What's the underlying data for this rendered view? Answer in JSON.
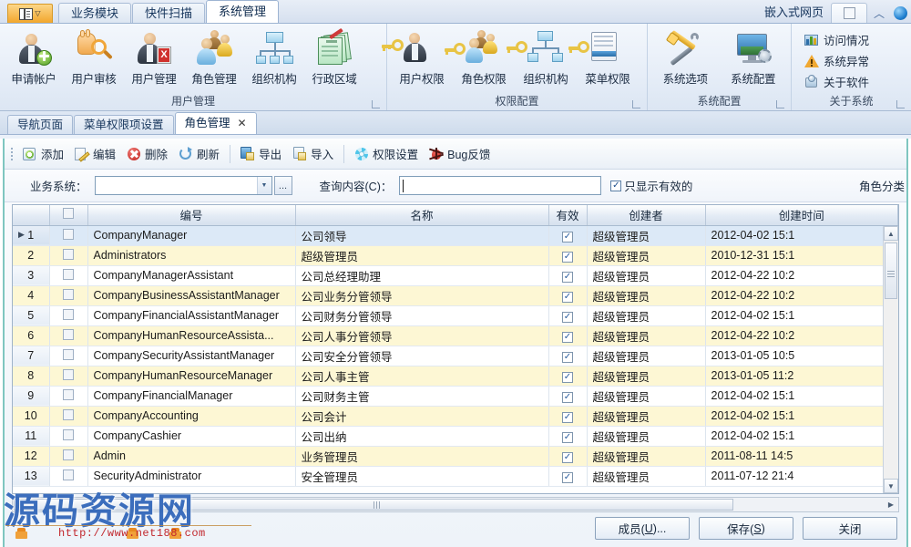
{
  "window": {
    "app_menu_icon": "book-menu-icon",
    "main_tabs": [
      {
        "label": "业务模块",
        "active": false
      },
      {
        "label": "快件扫描",
        "active": false
      },
      {
        "label": "系统管理",
        "active": true
      }
    ],
    "embedded_page_label": "嵌入式网页",
    "restore_icon": "restore-window-icon",
    "collapse_icon": "chevron-up-icon",
    "help_icon": "globe-help-icon"
  },
  "ribbon": {
    "groups": [
      {
        "title": "用户管理",
        "buttons": [
          {
            "label": "申请帐户",
            "icon": "user-add-icon"
          },
          {
            "label": "用户审核",
            "icon": "user-review-magnifier-icon"
          },
          {
            "label": "用户管理",
            "icon": "user-manage-icon"
          },
          {
            "label": "角色管理",
            "icon": "role-group-icon"
          },
          {
            "label": "组织机构",
            "icon": "org-chart-icon"
          },
          {
            "label": "行政区域",
            "icon": "region-book-icon"
          }
        ]
      },
      {
        "title": "权限配置",
        "buttons": [
          {
            "label": "用户权限",
            "icon": "user-key-icon"
          },
          {
            "label": "角色权限",
            "icon": "role-key-icon"
          },
          {
            "label": "组织机构",
            "icon": "org-key-icon"
          },
          {
            "label": "菜单权限",
            "icon": "menu-key-icon"
          }
        ]
      },
      {
        "title": "系统配置",
        "buttons": [
          {
            "label": "系统选项",
            "icon": "tools-icon"
          },
          {
            "label": "系统配置",
            "icon": "monitor-gear-icon"
          }
        ]
      },
      {
        "title": "关于系统",
        "small_buttons": [
          {
            "label": "访问情况",
            "icon": "visit-stats-icon"
          },
          {
            "label": "系统异常",
            "icon": "warning-triangle-icon"
          },
          {
            "label": "关于软件",
            "icon": "about-software-icon"
          }
        ]
      }
    ]
  },
  "doc_tabs": [
    {
      "label": "导航页面",
      "active": false,
      "closable": false
    },
    {
      "label": "菜单权限项设置",
      "active": false,
      "closable": false
    },
    {
      "label": "角色管理",
      "active": true,
      "closable": true,
      "close_icon": "close-icon"
    }
  ],
  "toolbar": {
    "buttons": [
      {
        "label": "添加",
        "icon": "add-icon"
      },
      {
        "label": "编辑",
        "icon": "edit-pencil-icon"
      },
      {
        "label": "删除",
        "icon": "delete-x-icon"
      },
      {
        "label": "刷新",
        "icon": "refresh-icon"
      }
    ],
    "buttons2": [
      {
        "label": "导出",
        "icon": "export-icon"
      },
      {
        "label": "导入",
        "icon": "import-icon"
      }
    ],
    "buttons3": [
      {
        "label": "权限设置",
        "icon": "gear-icon"
      },
      {
        "label": "Bug反馈",
        "icon": "bug-icon"
      }
    ]
  },
  "filter": {
    "system_label": "业务系统：",
    "system_value": "",
    "system_placeholder": "",
    "dropdown_icon": "chevron-down-icon",
    "ellipsis_label": "...",
    "query_label": "查询内容(C)：",
    "query_value": "",
    "only_valid_label": "只显示有效的",
    "only_valid_checked": true,
    "role_class_label": "角色分类"
  },
  "grid": {
    "columns": [
      "",
      "",
      "编号",
      "名称",
      "有效",
      "创建者",
      "创建时间"
    ],
    "header_checkbox_icon": "select-all-checkbox",
    "rows": [
      {
        "idx": "1",
        "code": "CompanyManager",
        "name": "公司领导",
        "valid": true,
        "creator": "超级管理员",
        "time": "2012-04-02 15:1",
        "selected": true,
        "alt": false
      },
      {
        "idx": "2",
        "code": "Administrators",
        "name": "超级管理员",
        "valid": true,
        "creator": "超级管理员",
        "time": "2010-12-31 15:1",
        "selected": false,
        "alt": true
      },
      {
        "idx": "3",
        "code": "CompanyManagerAssistant",
        "name": "公司总经理助理",
        "valid": true,
        "creator": "超级管理员",
        "time": "2012-04-22 10:2",
        "selected": false,
        "alt": false
      },
      {
        "idx": "4",
        "code": "CompanyBusinessAssistantManager",
        "name": "公司业务分管领导",
        "valid": true,
        "creator": "超级管理员",
        "time": "2012-04-22 10:2",
        "selected": false,
        "alt": true
      },
      {
        "idx": "5",
        "code": "CompanyFinancialAssistantManager",
        "name": "公司财务分管领导",
        "valid": true,
        "creator": "超级管理员",
        "time": "2012-04-02 15:1",
        "selected": false,
        "alt": false
      },
      {
        "idx": "6",
        "code": "CompanyHumanResourceAssista...",
        "name": "公司人事分管领导",
        "valid": true,
        "creator": "超级管理员",
        "time": "2012-04-22 10:2",
        "selected": false,
        "alt": true
      },
      {
        "idx": "7",
        "code": "CompanySecurityAssistantManager",
        "name": "公司安全分管领导",
        "valid": true,
        "creator": "超级管理员",
        "time": "2013-01-05 10:5",
        "selected": false,
        "alt": false
      },
      {
        "idx": "8",
        "code": "CompanyHumanResourceManager",
        "name": "公司人事主管",
        "valid": true,
        "creator": "超级管理员",
        "time": "2013-01-05 11:2",
        "selected": false,
        "alt": true
      },
      {
        "idx": "9",
        "code": "CompanyFinancialManager",
        "name": "公司财务主管",
        "valid": true,
        "creator": "超级管理员",
        "time": "2012-04-02 15:1",
        "selected": false,
        "alt": false
      },
      {
        "idx": "10",
        "code": "CompanyAccounting",
        "name": "公司会计",
        "valid": true,
        "creator": "超级管理员",
        "time": "2012-04-02 15:1",
        "selected": false,
        "alt": true
      },
      {
        "idx": "11",
        "code": "CompanyCashier",
        "name": "公司出纳",
        "valid": true,
        "creator": "超级管理员",
        "time": "2012-04-02 15:1",
        "selected": false,
        "alt": false
      },
      {
        "idx": "12",
        "code": "Admin",
        "name": "业务管理员",
        "valid": true,
        "creator": "超级管理员",
        "time": "2011-08-11 14:5",
        "selected": false,
        "alt": true
      },
      {
        "idx": "13",
        "code": "SecurityAdministrator",
        "name": "安全管理员",
        "valid": true,
        "creator": "超级管理员",
        "time": "2011-07-12 21:4",
        "selected": false,
        "alt": false
      }
    ]
  },
  "footer": {
    "buttons": [
      {
        "label": "成员(U)...",
        "name": "members-button"
      },
      {
        "label": "保存(S)",
        "name": "save-button"
      },
      {
        "label": "关闭",
        "name": "close-button"
      }
    ]
  },
  "watermark": {
    "title": "源码资源网",
    "url": "http://www.net188.com"
  },
  "colors": {
    "accent": "#2d63b8",
    "tab_active": "#ffffff",
    "alt_row": "#fdf7d4",
    "selected_row": "#dce9f7",
    "pane_edge": "#7fc6c0",
    "watermark_url": "#c1272d"
  }
}
